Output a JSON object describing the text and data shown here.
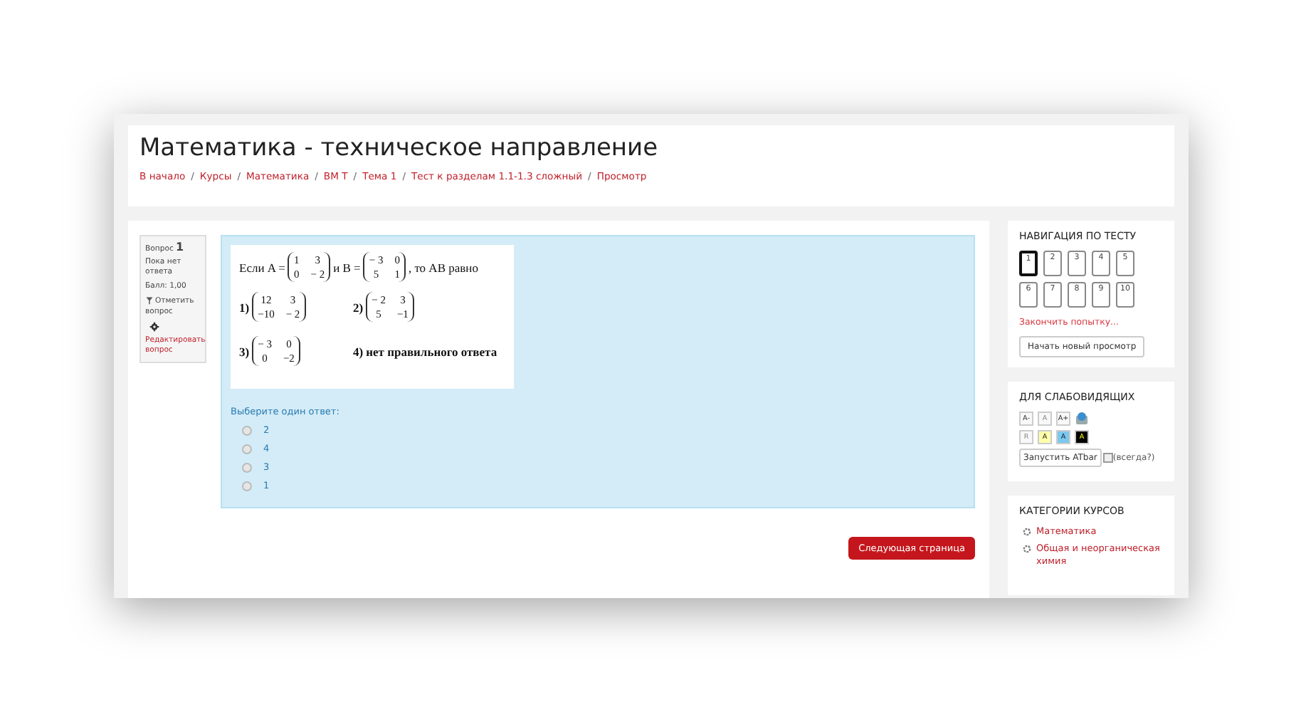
{
  "header": {
    "title": "Математика - техническое направление",
    "breadcrumbs": [
      "В начало",
      "Курсы",
      "Математика",
      "ВМ Т",
      "Тема 1",
      "Тест к разделам 1.1-1.3 сложный",
      "Просмотр"
    ],
    "separator": "/"
  },
  "question_info": {
    "label": "Вопрос",
    "number": "1",
    "status": "Пока нет ответа",
    "mark": "Балл: 1,00",
    "flag": "Отметить вопрос",
    "edit": "Редактировать вопрос"
  },
  "question": {
    "stem": {
      "prefix": "Если A =",
      "matrix_a": [
        [
          "1",
          "3"
        ],
        [
          "0",
          "− 2"
        ]
      ],
      "middle": "и B =",
      "matrix_b": [
        [
          "− 3",
          "0"
        ],
        [
          "5",
          "1"
        ]
      ],
      "suffix": ", то AB равно"
    },
    "options": [
      {
        "kind": "matrix",
        "label": "1)",
        "matrix": [
          [
            "12",
            "3"
          ],
          [
            "−10",
            "− 2"
          ]
        ]
      },
      {
        "kind": "matrix",
        "label": "2)",
        "matrix": [
          [
            "− 2",
            "3"
          ],
          [
            "5",
            "−1"
          ]
        ]
      },
      {
        "kind": "matrix",
        "label": "3)",
        "matrix": [
          [
            "− 3",
            "0"
          ],
          [
            "0",
            "−2"
          ]
        ]
      },
      {
        "kind": "text",
        "label": "4)",
        "text": "нет правильного ответа"
      }
    ],
    "prompt": "Выберите один ответ:",
    "answers": [
      {
        "label": "2",
        "selected": false
      },
      {
        "label": "4",
        "selected": false
      },
      {
        "label": "3",
        "selected": false
      },
      {
        "label": "1",
        "selected": false
      }
    ]
  },
  "next_button": "Следующая страница",
  "quiz_nav": {
    "title": "НАВИГАЦИЯ ПО ТЕСТУ",
    "questions": [
      {
        "label": "1",
        "selected": true
      },
      {
        "label": "2",
        "selected": false
      },
      {
        "label": "3",
        "selected": false
      },
      {
        "label": "4",
        "selected": false
      },
      {
        "label": "5",
        "selected": false
      },
      {
        "label": "6",
        "selected": false
      },
      {
        "label": "7",
        "selected": false
      },
      {
        "label": "8",
        "selected": false
      },
      {
        "label": "9",
        "selected": false
      },
      {
        "label": "10",
        "selected": false
      }
    ],
    "finish": "Закончить попытку...",
    "new_preview": "Начать новый просмотр"
  },
  "accessibility": {
    "title": "ДЛЯ СЛАБОВИДЯЩИХ",
    "rows": [
      [
        {
          "kind": "plain",
          "label": "A-"
        },
        {
          "kind": "disabled",
          "label": "A"
        },
        {
          "kind": "plain",
          "label": "A+"
        },
        {
          "kind": "icon"
        }
      ],
      [
        {
          "kind": "disabled",
          "label": "R"
        },
        {
          "kind": "yellow",
          "label": "A"
        },
        {
          "kind": "blue",
          "label": "A"
        },
        {
          "kind": "black",
          "label": "A"
        }
      ]
    ],
    "launch": "Запустить ATbar",
    "always": {
      "label": "(всегда?)",
      "checked": false
    }
  },
  "categories": {
    "title": "КАТЕГОРИИ КУРСОВ",
    "items": [
      "Математика",
      "Общая и неорганическая химия"
    ]
  }
}
